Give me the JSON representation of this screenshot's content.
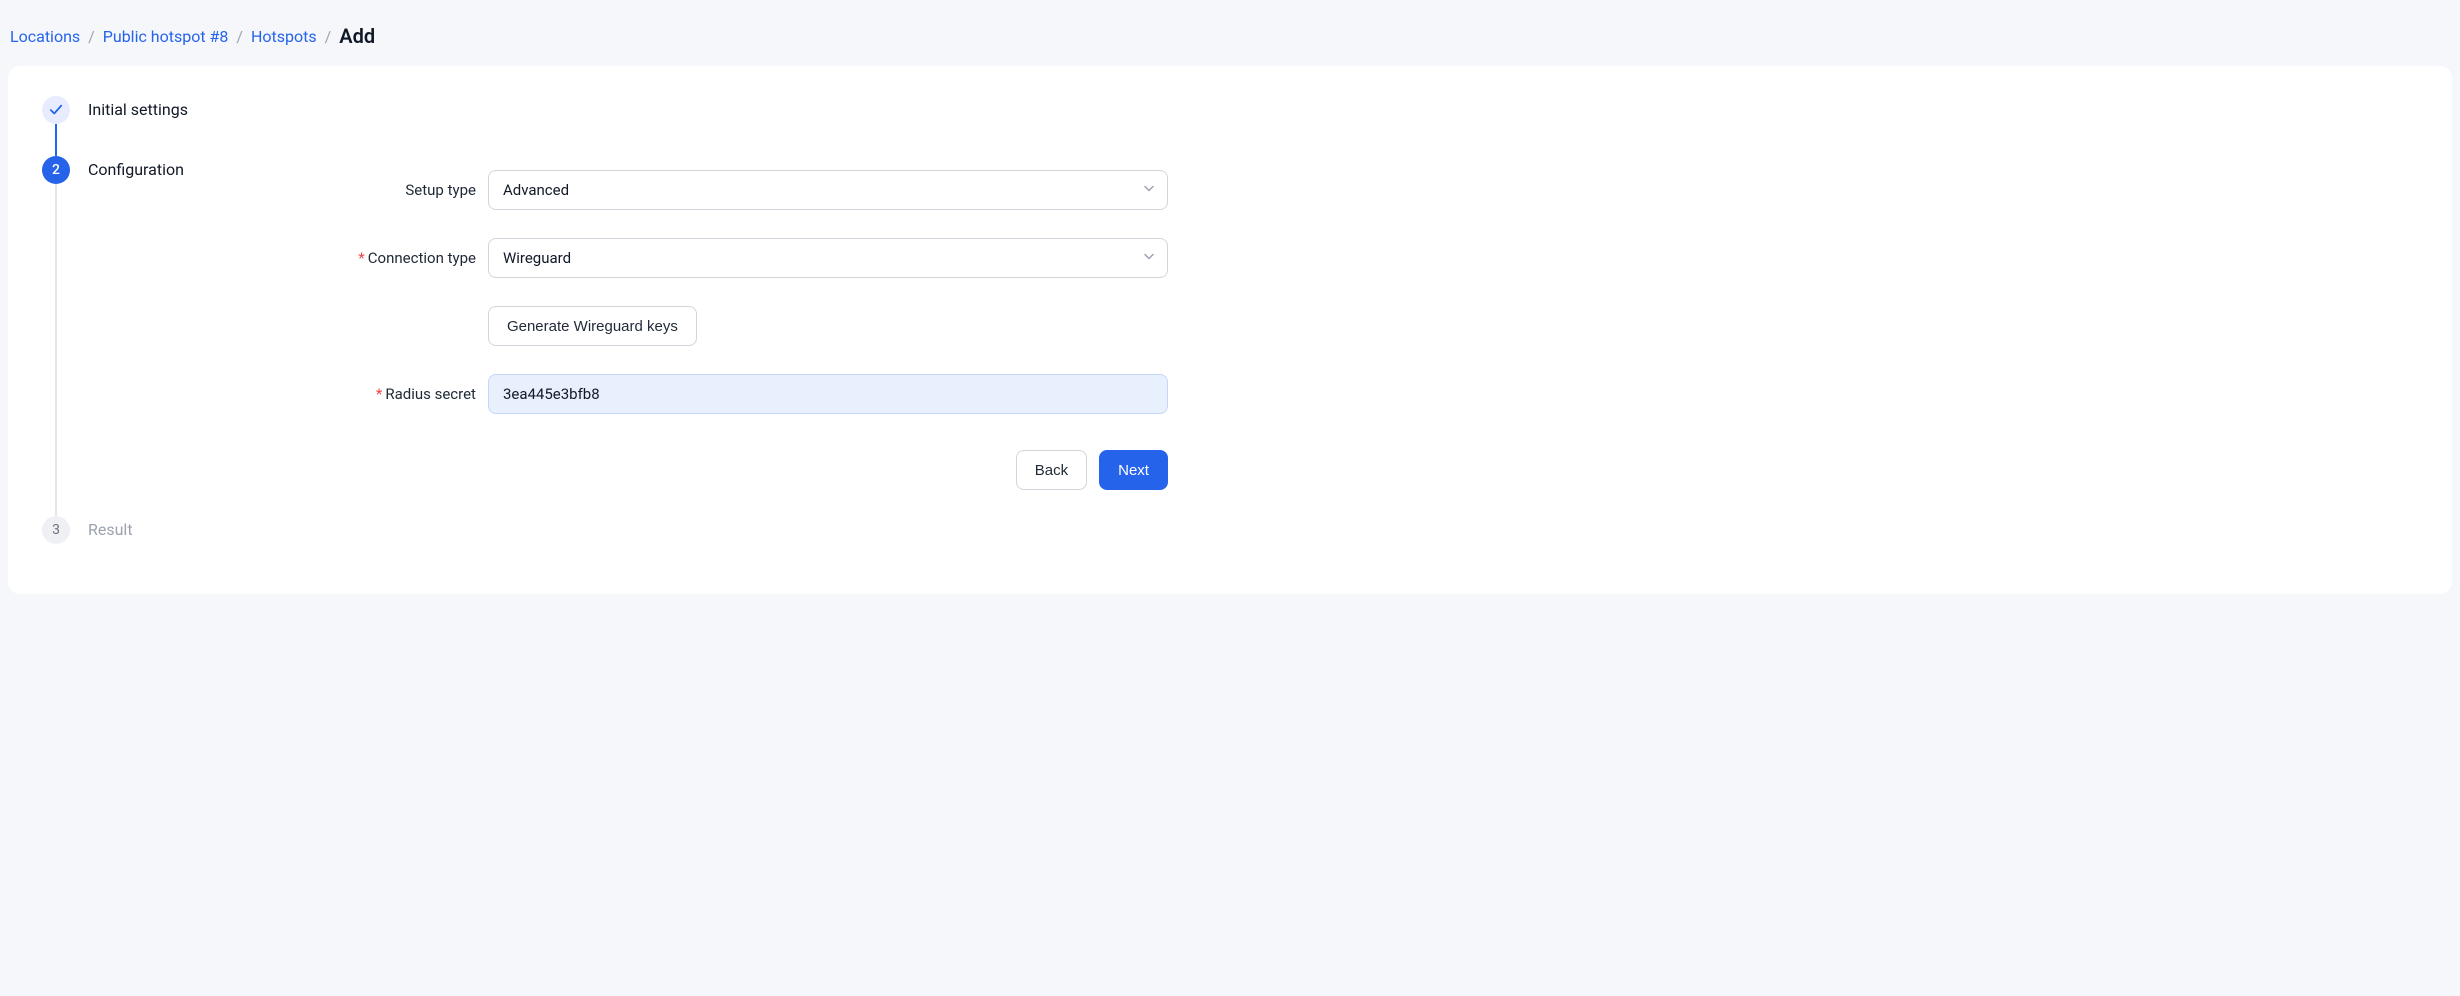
{
  "breadcrumb": {
    "items": [
      {
        "label": "Locations"
      },
      {
        "label": "Public hotspot #8"
      },
      {
        "label": "Hotspots"
      }
    ],
    "current": "Add"
  },
  "steps": {
    "s1": {
      "title": "Initial settings"
    },
    "s2": {
      "title": "Configuration",
      "num": "2"
    },
    "s3": {
      "title": "Result",
      "num": "3"
    }
  },
  "form": {
    "setup_type": {
      "label": "Setup type",
      "value": "Advanced"
    },
    "connection_type": {
      "label": "Connection type",
      "value": "Wireguard"
    },
    "generate_keys": {
      "label": "Generate Wireguard keys"
    },
    "radius_secret": {
      "label": "Radius secret",
      "value": "3ea445e3bfb8"
    }
  },
  "actions": {
    "back": "Back",
    "next": "Next"
  }
}
